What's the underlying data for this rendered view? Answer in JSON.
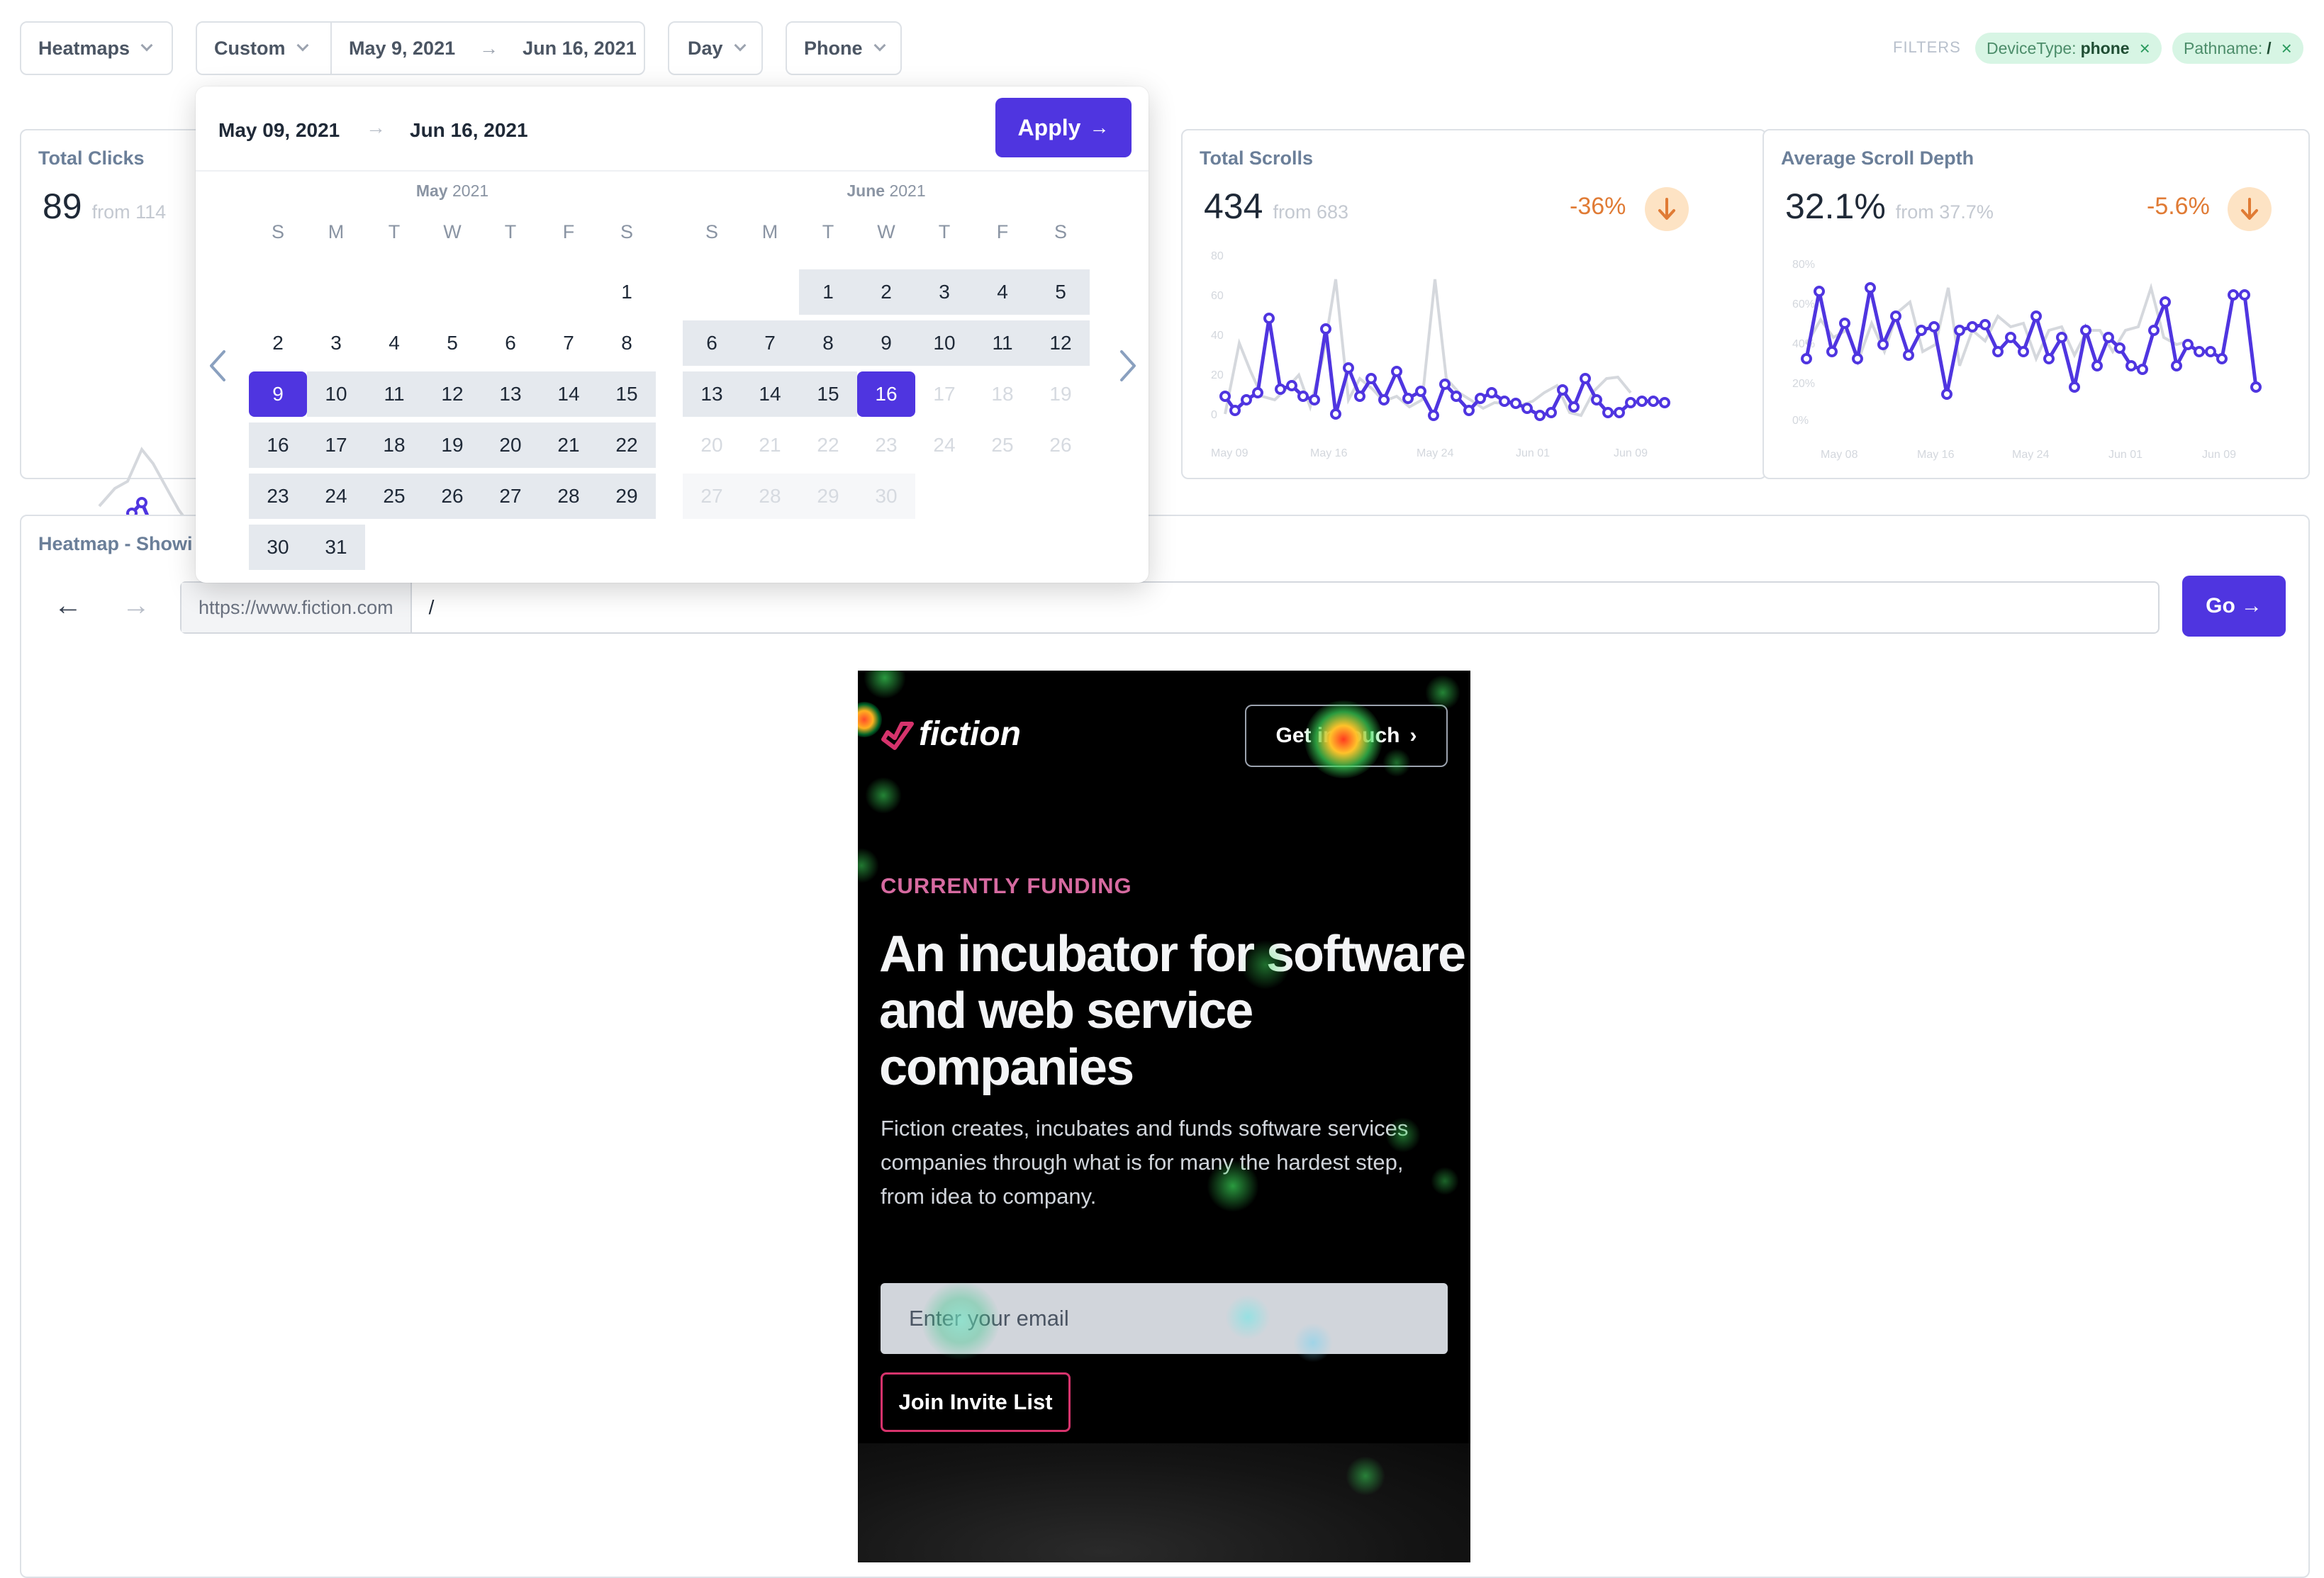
{
  "toolbar": {
    "type_label": "Heatmaps",
    "range_label": "Custom",
    "start_date": "May 9, 2021",
    "end_date": "Jun 16, 2021",
    "interval_label": "Day",
    "device_label": "Phone"
  },
  "filters": {
    "label": "FILTERS",
    "chips": [
      {
        "key": "DeviceType:",
        "value": "phone"
      },
      {
        "key": "Pathname:",
        "value": "/"
      }
    ]
  },
  "stats": [
    {
      "title": "Total Clicks",
      "value": "89",
      "from": "from 114"
    },
    {
      "title": "Total Scrolls",
      "value": "434",
      "from": "from 683",
      "change": "-36%"
    },
    {
      "title": "Average Scroll Depth",
      "value": "32.1%",
      "from": "from 37.7%",
      "change": "-5.6%"
    }
  ],
  "calendar": {
    "start_display": "May 09, 2021",
    "end_display": "Jun 16, 2021",
    "apply_label": "Apply",
    "weekdays": [
      "S",
      "M",
      "T",
      "W",
      "T",
      "F",
      "S"
    ],
    "months": [
      {
        "name": "May",
        "year": "2021",
        "first_weekday": 6,
        "days": 31,
        "range_start": 9,
        "range_end": 31,
        "disabled_from": 32
      },
      {
        "name": "June",
        "year": "2021",
        "first_weekday": 2,
        "days": 30,
        "range_start": 1,
        "range_end": 16,
        "disabled_from": 17
      }
    ]
  },
  "heatmap": {
    "title": "Heatmap - Showi",
    "url_base": "https://www.fiction.com",
    "path": "/",
    "go_label": "Go"
  },
  "site": {
    "logo_text": "fiction",
    "cta": "Get in touch",
    "eyebrow": "CURRENTLY FUNDING",
    "headline_lines": [
      "An incubator for software",
      "and web service",
      "companies"
    ],
    "body_lines": [
      "Fiction creates, incubates and funds software services",
      "companies through what is for many the hardest step,",
      "from idea to company."
    ],
    "email_placeholder": "Enter your email",
    "join_label": "Join Invite List"
  },
  "colors": {
    "primary": "#4f35e0",
    "accent_orange": "#e07b35",
    "eyebrow_pink": "#d66aa0",
    "chip_bg": "#d7f5e4"
  }
}
